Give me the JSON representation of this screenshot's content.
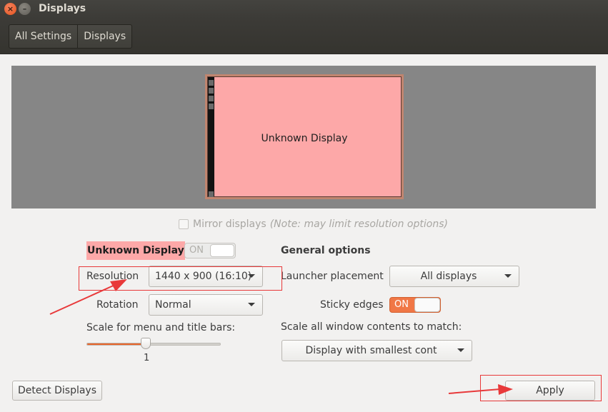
{
  "window": {
    "title": "Displays",
    "close_glyph": "×",
    "minimize_glyph": "–",
    "close_icon": "close-icon",
    "minimize_icon": "minimize-icon"
  },
  "breadcrumbs": [
    {
      "label": "All Settings"
    },
    {
      "label": "Displays"
    }
  ],
  "arrangement": {
    "monitor_label": "Unknown Display",
    "monitor_color": "#fda8a8"
  },
  "mirror": {
    "label": "Mirror displays",
    "note": "(Note: may limit resolution options)",
    "checked": false
  },
  "display_settings": {
    "display_name": "Unknown Display",
    "power_toggle": {
      "state_label": "ON",
      "enabled": false
    },
    "resolution_label": "Resolution",
    "resolution_value": "1440 x 900 (16:10)",
    "rotation_label": "Rotation",
    "rotation_value": "Normal",
    "scale_label": "Scale for menu and title bars:",
    "scale_value": "1",
    "scale_fraction": 0.44
  },
  "general_options": {
    "heading": "General options",
    "launcher_label": "Launcher placement",
    "launcher_value": "All displays",
    "sticky_label": "Sticky edges",
    "sticky_toggle": {
      "state_label": "ON",
      "enabled": true
    },
    "scale_all_label": "Scale all window contents to match:",
    "scale_all_value": "Display with smallest cont"
  },
  "buttons": {
    "detect": "Detect Displays",
    "apply": "Apply"
  },
  "colors": {
    "accent": "#f07746",
    "annotation": "#e8393a"
  }
}
